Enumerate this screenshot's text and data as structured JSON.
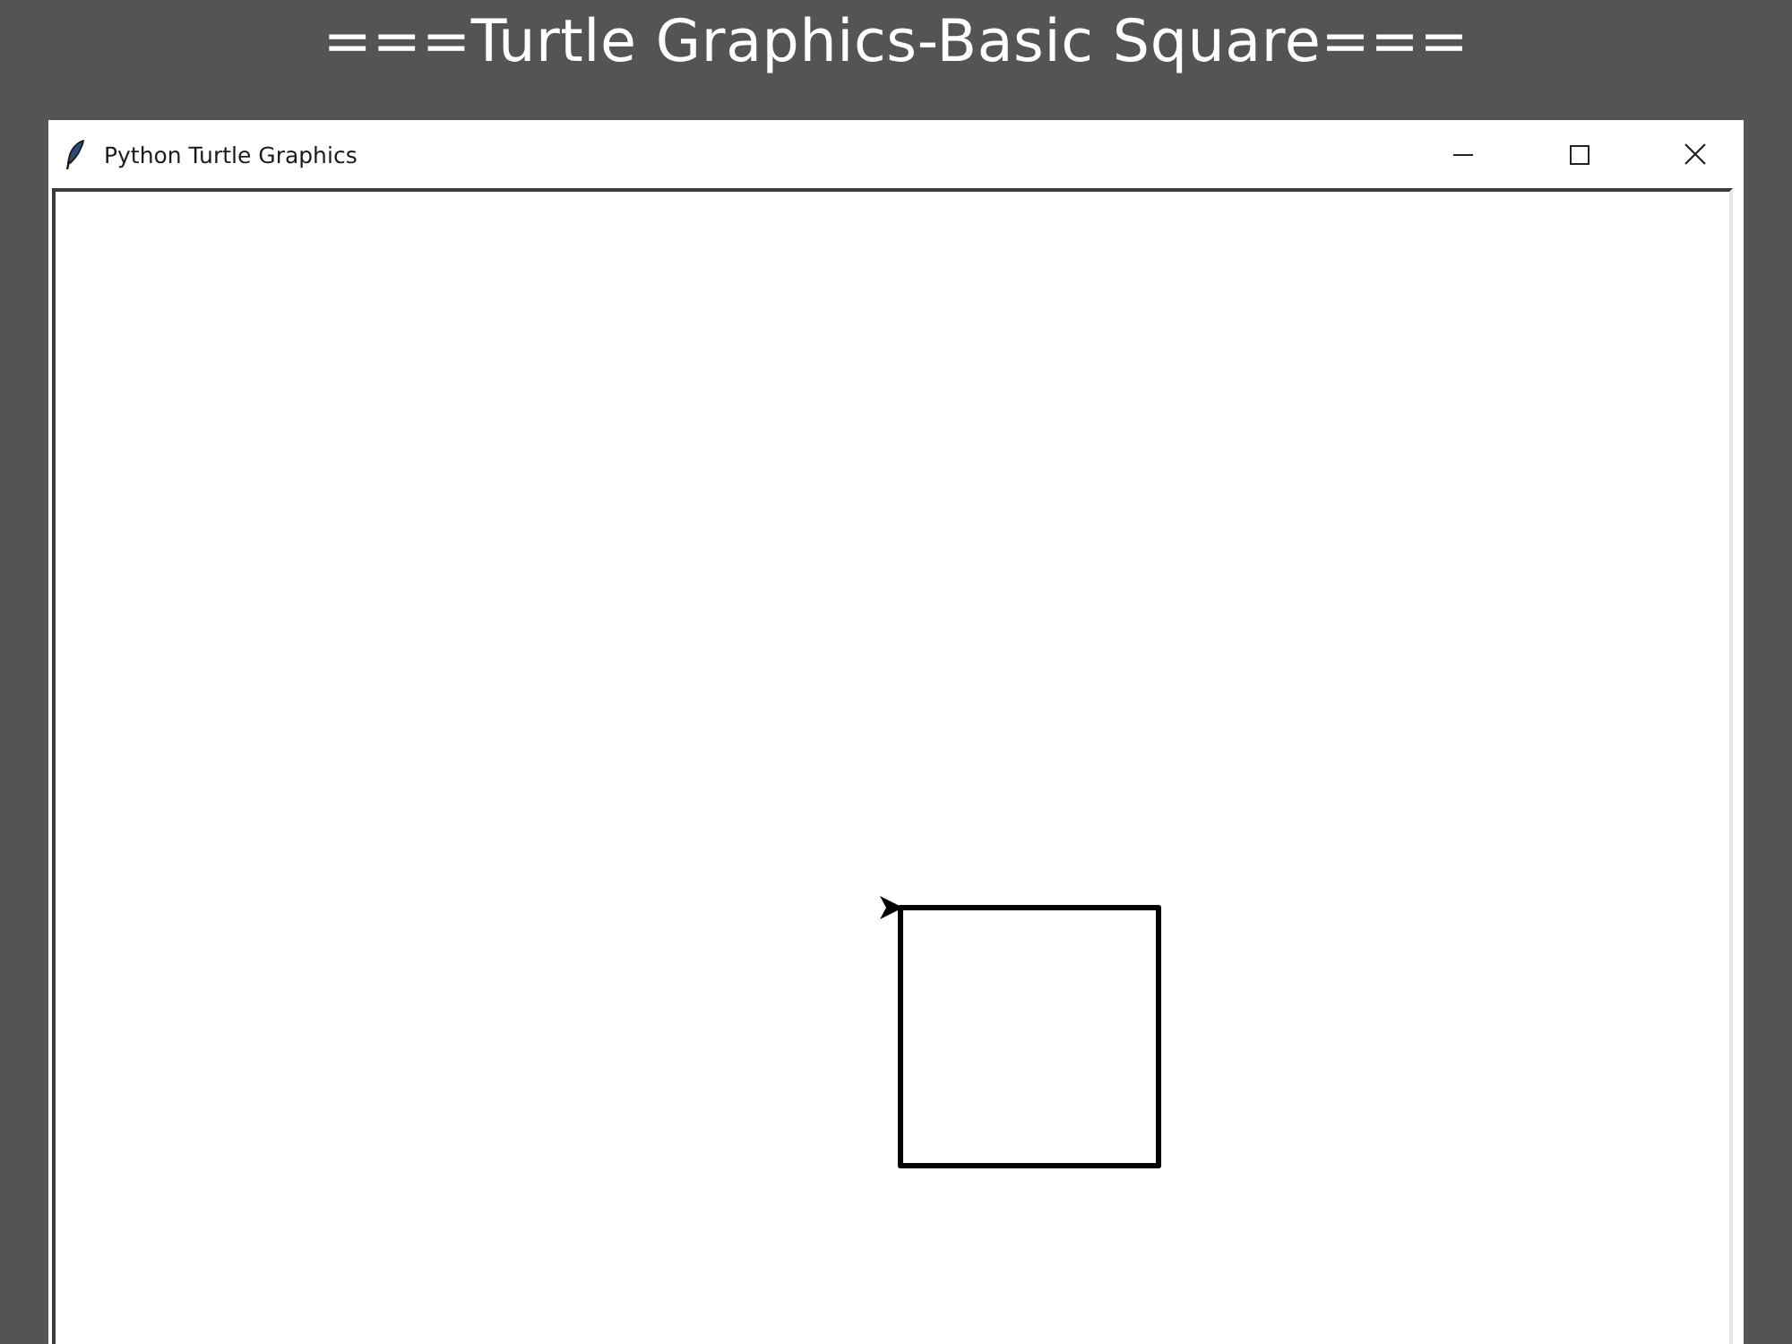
{
  "heading": "===Turtle Graphics-Basic Square===",
  "window": {
    "title": "Python Turtle Graphics"
  }
}
